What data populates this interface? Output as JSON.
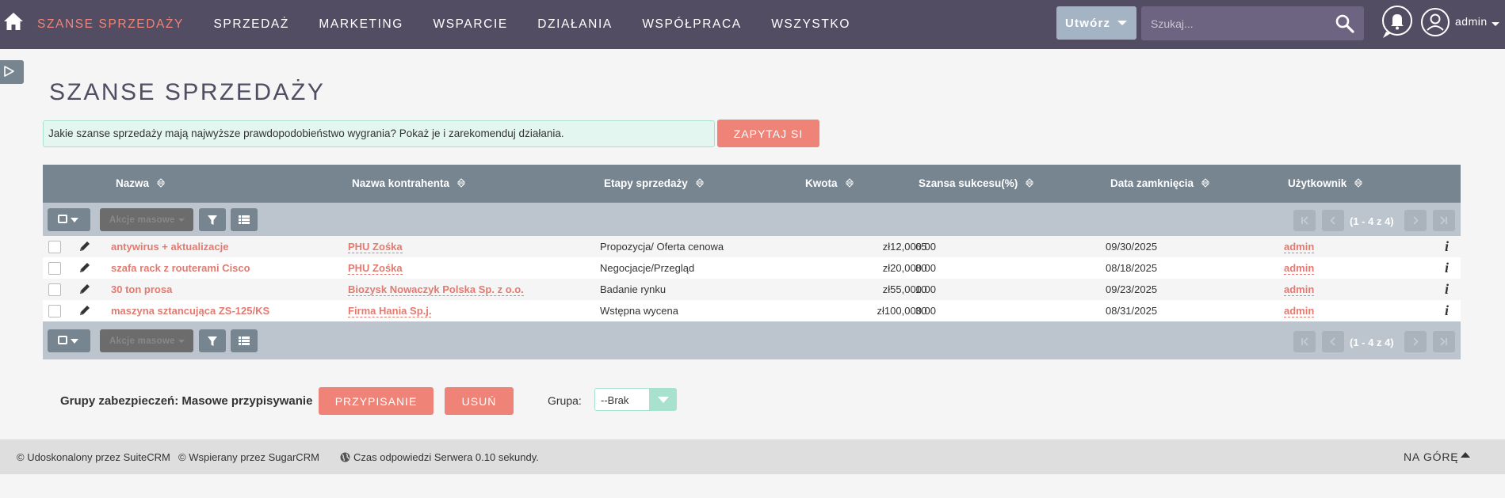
{
  "nav": {
    "items": [
      "SZANSE SPRZEDAŻY",
      "SPRZEDAŻ",
      "MARKETING",
      "WSPARCIE",
      "DZIAŁANIA",
      "WSPÓŁPRACA",
      "WSZYSTKO"
    ],
    "active_index": 0,
    "create_label": "Utwórz",
    "search_placeholder": "Szukaj...",
    "user_name": "admin"
  },
  "page": {
    "title": "SZANSE SPRZEDAŻY"
  },
  "ai": {
    "prompt_text": "Jakie szanse sprzedaży mają najwyższe prawdopodobieństwo wygrania? Pokaż je i zarekomenduj działania.",
    "ask_label": "ZAPYTAJ SI"
  },
  "table": {
    "columns": [
      "Nazwa",
      "Nazwa kontrahenta",
      "Etapy sprzedaży",
      "Kwota",
      "Szansa sukcesu(%)",
      "Data zamknięcia",
      "Użytkownik"
    ],
    "mass_actions_label": "Akcje masowe",
    "pagination_text": "(1 - 4 z 4)",
    "rows": [
      {
        "name": "antywirus + aktualizacje",
        "account": "PHU Zośka",
        "stage": "Propozycja/ Oferta cenowa",
        "amount": "zł12,000.00",
        "probability": "65",
        "close_date": "09/30/2025",
        "user": "admin"
      },
      {
        "name": "szafa rack z routerami Cisco",
        "account": "PHU Zośka",
        "stage": "Negocjacje/Przegląd",
        "amount": "zł20,000.00",
        "probability": "80",
        "close_date": "08/18/2025",
        "user": "admin"
      },
      {
        "name": "30 ton prosa",
        "account": "Biozysk Nowaczyk Polska Sp. z o.o.",
        "stage": "Badanie rynku",
        "amount": "zł55,000.00",
        "probability": "10",
        "close_date": "09/23/2025",
        "user": "admin"
      },
      {
        "name": "maszyna sztancująca ZS-125/KS",
        "account": "Firma Hania Sp.j.",
        "stage": "Wstępna wycena",
        "amount": "zł100,000.00",
        "probability": "30",
        "close_date": "08/31/2025",
        "user": "admin"
      }
    ],
    "info_glyph": "i"
  },
  "security": {
    "label": "Grupy zabezpieczeń: Masowe przypisywanie",
    "assign_label": "PRZYPISANIE",
    "remove_label": "USUŃ",
    "group_label": "Grupa:",
    "group_value": "--Brak"
  },
  "footer": {
    "suitecrm": "© Udoskonalony przez SuiteCRM",
    "sugarcrm": "© Wspierany przez SugarCRM",
    "server_time": "Czas odpowiedzi Serwera 0.10 sekundy.",
    "back_to_top": "NA GÓRĘ"
  },
  "colors": {
    "navbar": "#534d64",
    "accent": "#f08377",
    "table_header": "#778591",
    "ai_box": "#e3f6ef"
  }
}
